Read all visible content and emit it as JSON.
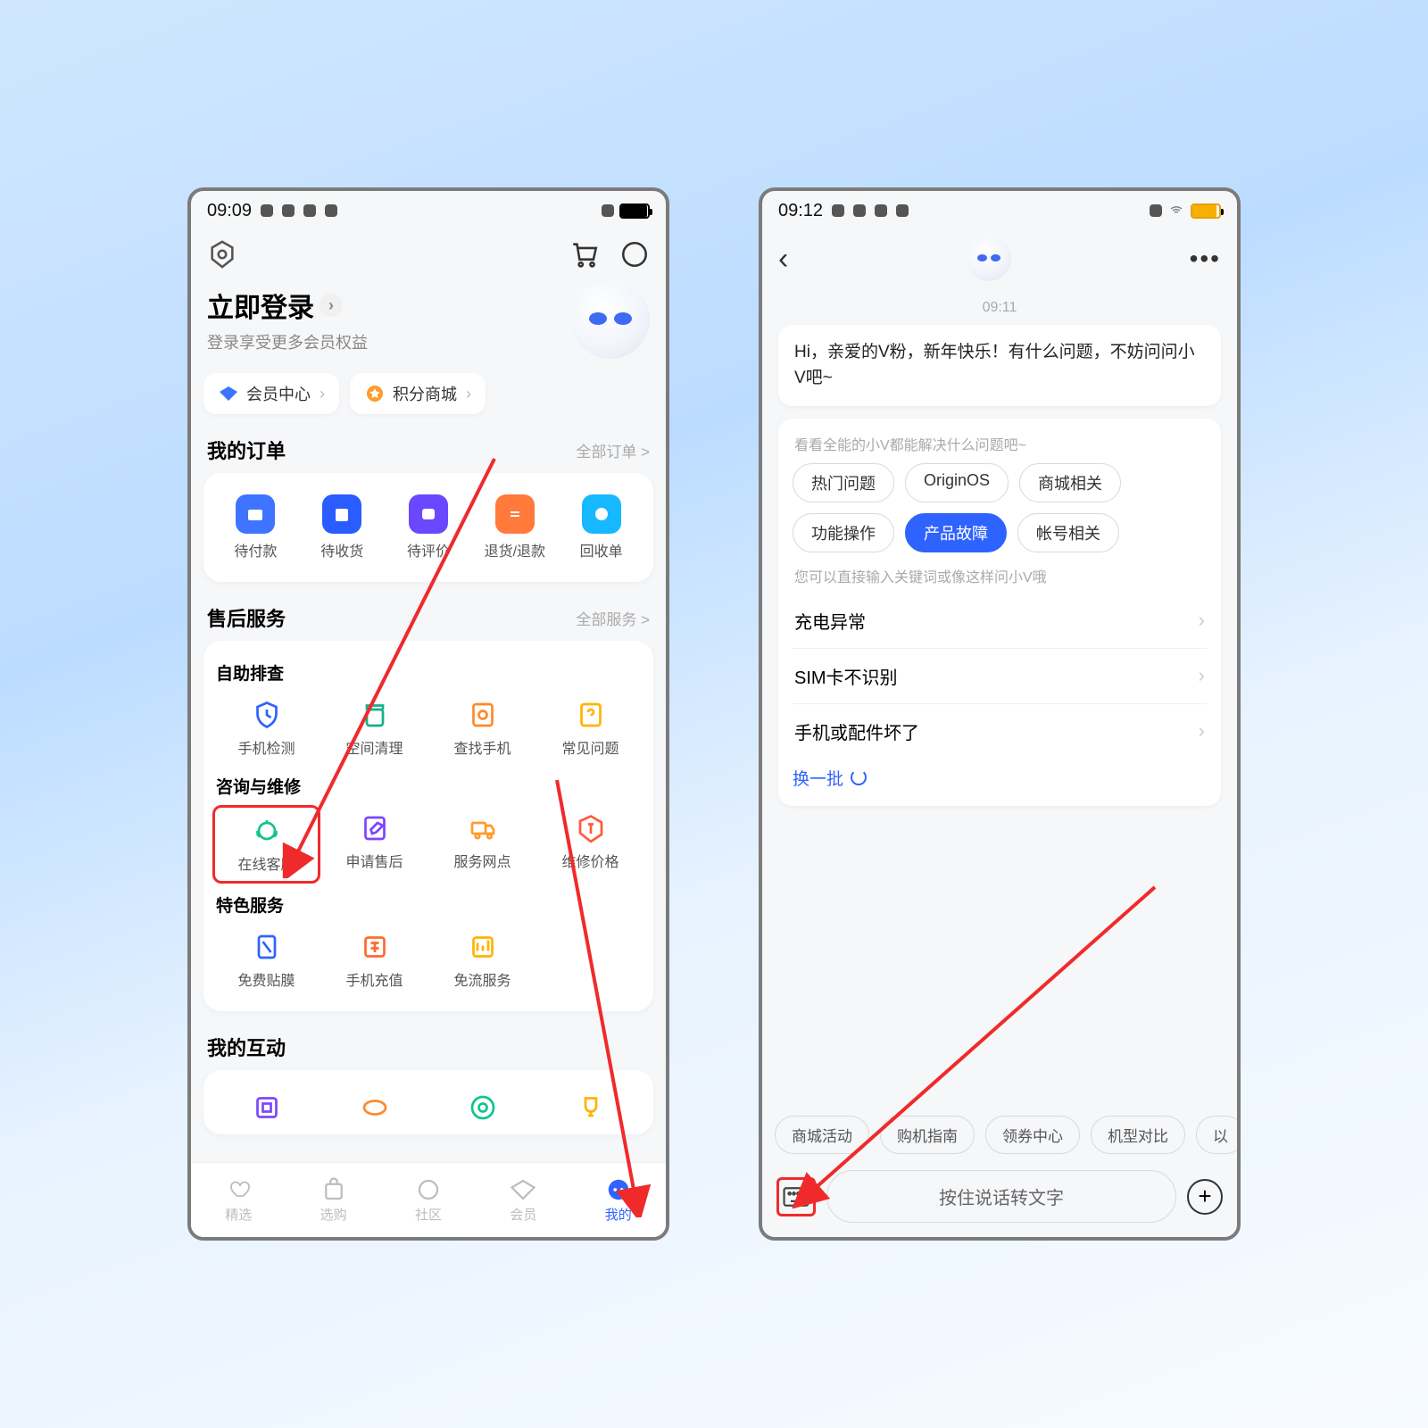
{
  "left": {
    "status": {
      "time": "09:09",
      "battery_pct": 95
    },
    "login": {
      "title": "立即登录",
      "subtitle": "登录享受更多会员权益"
    },
    "pills": {
      "member": "会员中心",
      "points": "积分商城"
    },
    "orders": {
      "title": "我的订单",
      "all": "全部订单 >",
      "items": [
        "待付款",
        "待收货",
        "待评价",
        "退货/退款",
        "回收单"
      ]
    },
    "service": {
      "title": "售后服务",
      "all": "全部服务 >",
      "group1_title": "自助排查",
      "group1": [
        "手机检测",
        "空间清理",
        "查找手机",
        "常见问题"
      ],
      "group2_title": "咨询与维修",
      "group2": [
        "在线客服",
        "申请售后",
        "服务网点",
        "维修价格"
      ],
      "group3_title": "特色服务",
      "group3": [
        "免费贴膜",
        "手机充值",
        "免流服务"
      ]
    },
    "interact": {
      "title": "我的互动"
    },
    "tabs": [
      "精选",
      "选购",
      "社区",
      "会员",
      "我的"
    ]
  },
  "right": {
    "status": {
      "time": "09:12",
      "battery_pct": 90
    },
    "chat": {
      "time": "09:11",
      "greeting": "Hi，亲爱的V粉，新年快乐！有什么问题，不妨问问小V吧~",
      "choices_hint": "看看全能的小V都能解决什么问题吧~",
      "chips": [
        "热门问题",
        "OriginOS",
        "商城相关",
        "功能操作",
        "产品故障",
        "帐号相关"
      ],
      "chip_selected": 4,
      "q_hint": "您可以直接输入关键词或像这样问小V哦",
      "questions": [
        "充电异常",
        "SIM卡不识别",
        "手机或配件坏了"
      ],
      "refresh": "换一批"
    },
    "quick": [
      "商城活动",
      "购机指南",
      "领券中心",
      "机型对比",
      "以"
    ],
    "input": {
      "voice": "按住说话转文字"
    }
  }
}
